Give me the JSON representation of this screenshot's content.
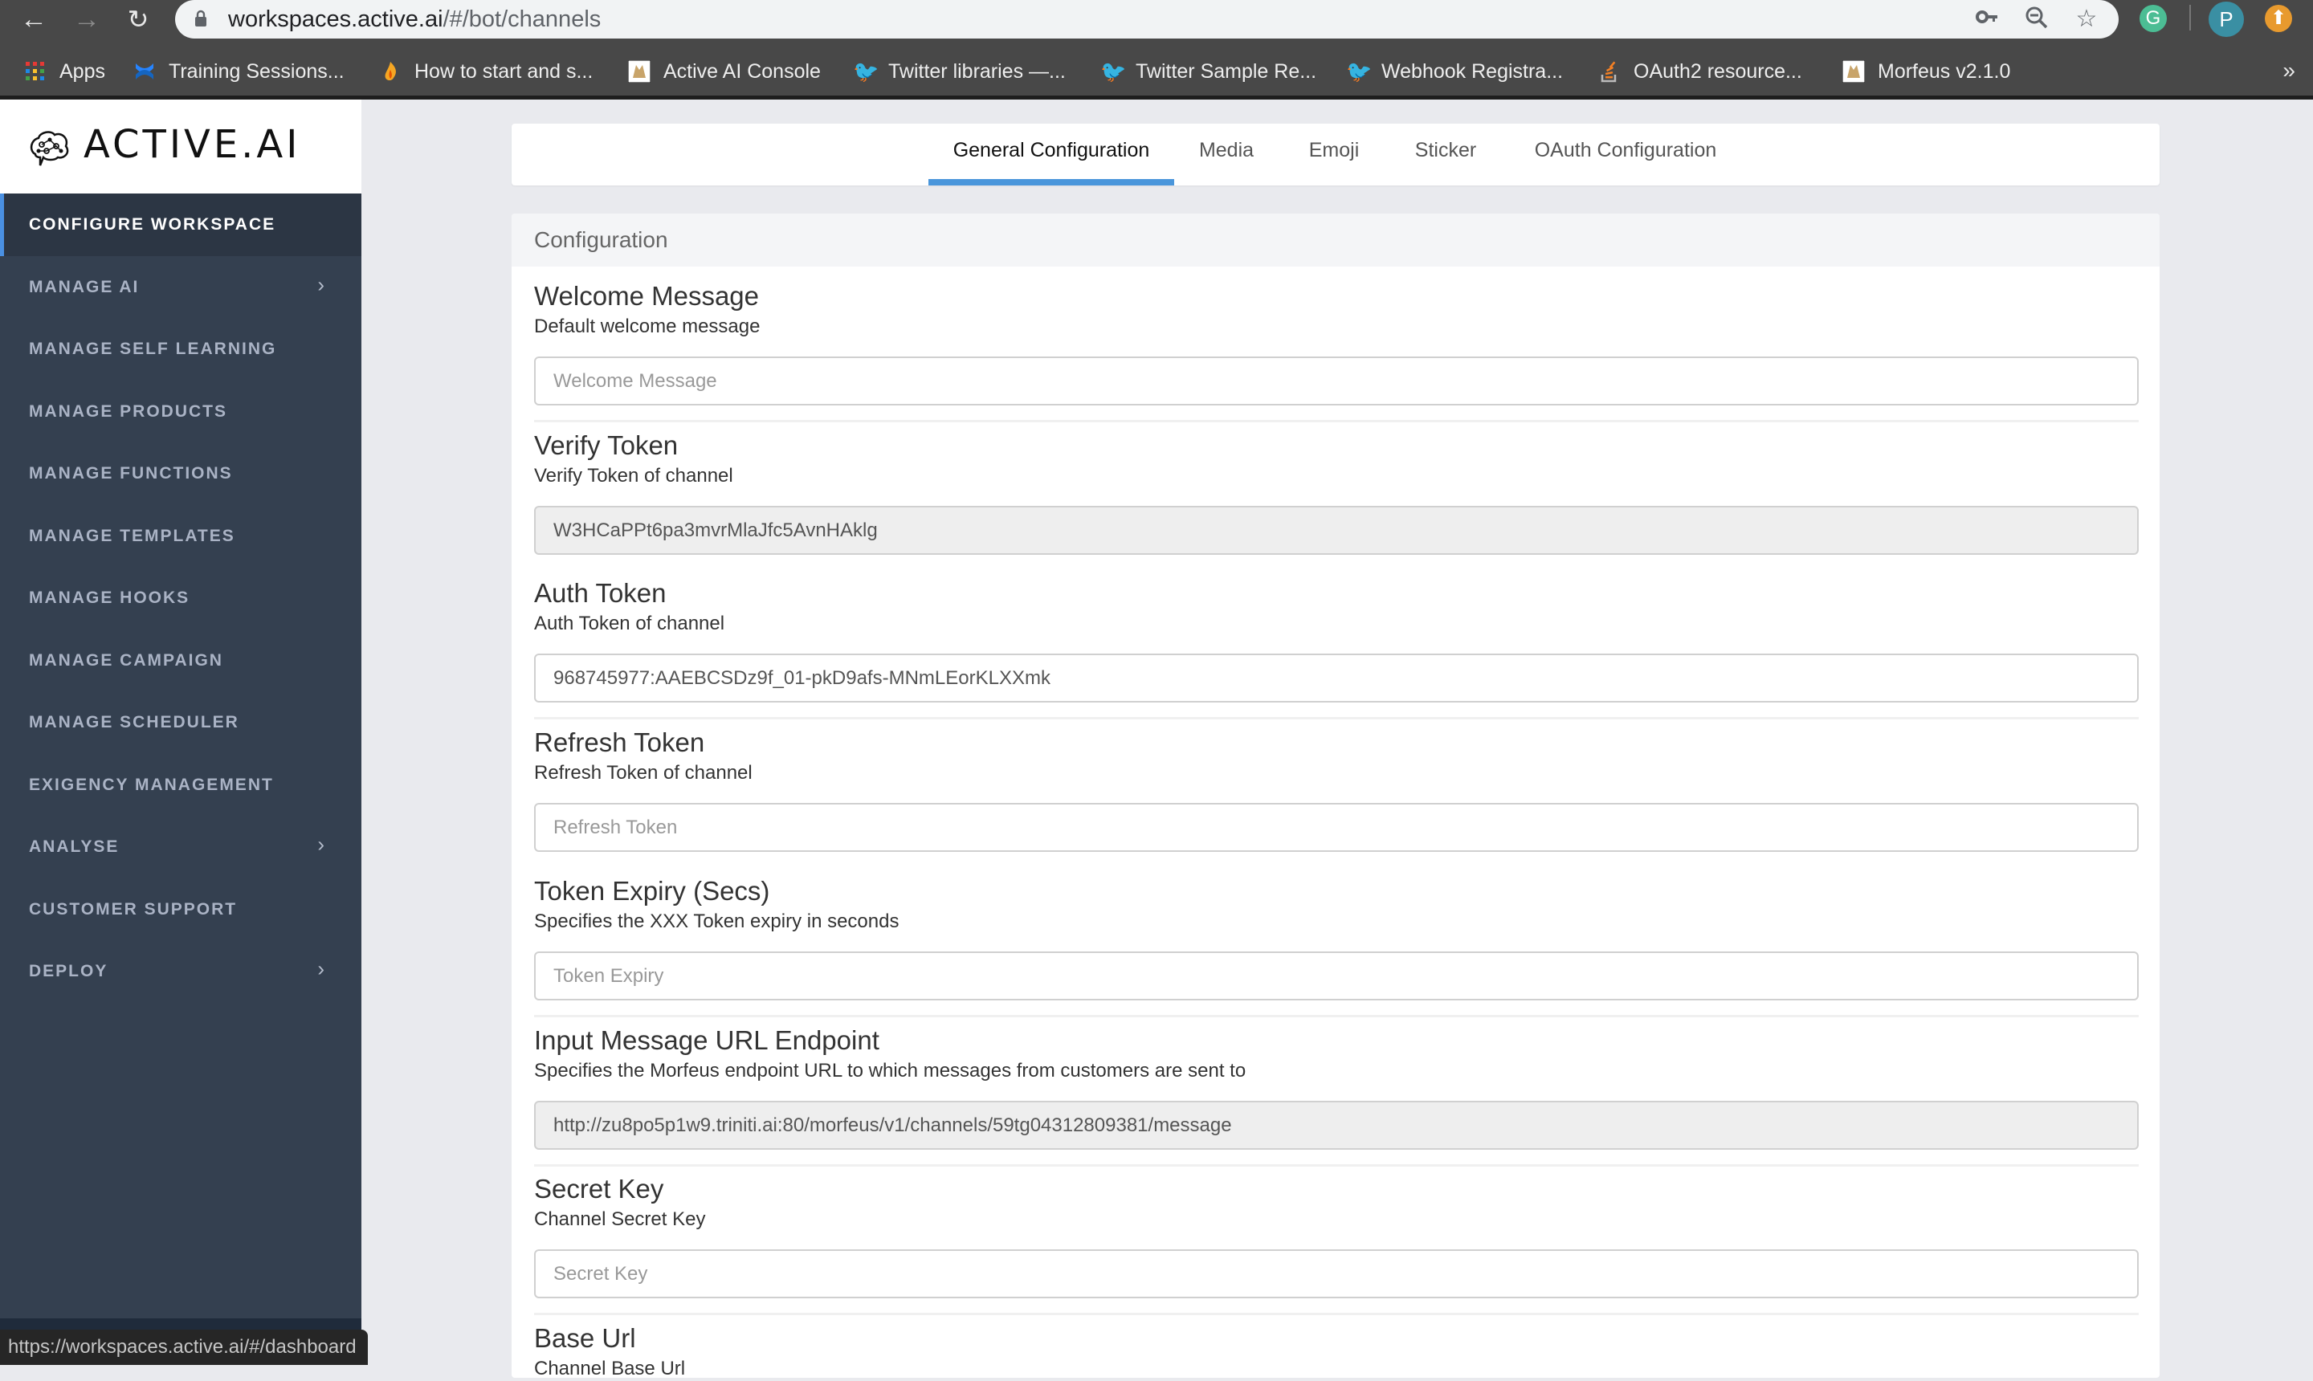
{
  "browser": {
    "url_host": "workspaces.active.ai",
    "url_path": "/#/bot/channels",
    "profile_initial": "P",
    "bookmarks": [
      {
        "label": "Apps",
        "icon": "apps-grid-icon"
      },
      {
        "label": "Training Sessions...",
        "icon": "confluence-icon"
      },
      {
        "label": "How to start and s...",
        "icon": "flame-icon"
      },
      {
        "label": "Active AI Console",
        "icon": "tomcat-icon"
      },
      {
        "label": "Twitter libraries —...",
        "icon": "twitter-icon"
      },
      {
        "label": "Twitter Sample Re...",
        "icon": "twitter-icon"
      },
      {
        "label": "Webhook Registra...",
        "icon": "twitter-icon"
      },
      {
        "label": "OAuth2 resource...",
        "icon": "stackoverflow-icon"
      },
      {
        "label": "Morfeus v2.1.0",
        "icon": "tomcat-icon"
      }
    ],
    "more_bookmarks": "»",
    "status_url": "https://workspaces.active.ai/#/dashboard"
  },
  "brand": {
    "name": "ACTIVE.AI"
  },
  "sidebar": {
    "items": [
      {
        "label": "CONFIGURE WORKSPACE",
        "active": true,
        "has_submenu": false
      },
      {
        "label": "MANAGE AI",
        "active": false,
        "has_submenu": true
      },
      {
        "label": "MANAGE SELF LEARNING",
        "active": false,
        "has_submenu": false
      },
      {
        "label": "MANAGE PRODUCTS",
        "active": false,
        "has_submenu": false
      },
      {
        "label": "MANAGE FUNCTIONS",
        "active": false,
        "has_submenu": false
      },
      {
        "label": "MANAGE TEMPLATES",
        "active": false,
        "has_submenu": false
      },
      {
        "label": "MANAGE HOOKS",
        "active": false,
        "has_submenu": false
      },
      {
        "label": "MANAGE CAMPAIGN",
        "active": false,
        "has_submenu": false
      },
      {
        "label": "MANAGE SCHEDULER",
        "active": false,
        "has_submenu": false
      },
      {
        "label": "EXIGENCY MANAGEMENT",
        "active": false,
        "has_submenu": false
      },
      {
        "label": "ANALYSE",
        "active": false,
        "has_submenu": true
      },
      {
        "label": "CUSTOMER SUPPORT",
        "active": false,
        "has_submenu": false
      },
      {
        "label": "DEPLOY",
        "active": false,
        "has_submenu": true
      }
    ]
  },
  "tabs": [
    {
      "label": "General Configuration",
      "active": true
    },
    {
      "label": "Media",
      "active": false
    },
    {
      "label": "Emoji",
      "active": false
    },
    {
      "label": "Sticker",
      "active": false
    },
    {
      "label": "OAuth Configuration",
      "active": false
    }
  ],
  "config": {
    "header": "Configuration",
    "fields": [
      {
        "title": "Welcome Message",
        "description": "Default welcome message",
        "value": "",
        "placeholder": "Welcome Message",
        "readonly": false
      },
      {
        "title": "Verify Token",
        "description": "Verify Token of channel",
        "value": "W3HCaPPt6pa3mvrMlaJfc5AvnHAklg",
        "placeholder": "",
        "readonly": true
      },
      {
        "title": "Auth Token",
        "description": "Auth Token of channel",
        "value": "968745977:AAEBCSDz9f_01-pkD9afs-MNmLEorKLXXmk",
        "placeholder": "",
        "readonly": false
      },
      {
        "title": "Refresh Token",
        "description": "Refresh Token of channel",
        "value": "",
        "placeholder": "Refresh Token",
        "readonly": false
      },
      {
        "title": "Token Expiry (Secs)",
        "description": "Specifies the XXX Token expiry in seconds",
        "value": "",
        "placeholder": "Token Expiry",
        "readonly": false
      },
      {
        "title": "Input Message URL Endpoint",
        "description": "Specifies the Morfeus endpoint URL to which messages from customers are sent to",
        "value": "http://zu8po5p1w9.triniti.ai:80/morfeus/v1/channels/59tg04312809381/message",
        "placeholder": "",
        "readonly": true
      },
      {
        "title": "Secret Key",
        "description": "Channel Secret Key",
        "value": "",
        "placeholder": "Secret Key",
        "readonly": false
      },
      {
        "title": "Base Url",
        "description": "Channel Base Url",
        "value": "",
        "placeholder": "",
        "readonly": false
      }
    ]
  },
  "colors": {
    "sidebar_bg": "#344050",
    "sidebar_active_bg": "#2c3644",
    "accent": "#4a96db",
    "page_bg": "#e9eaee"
  }
}
